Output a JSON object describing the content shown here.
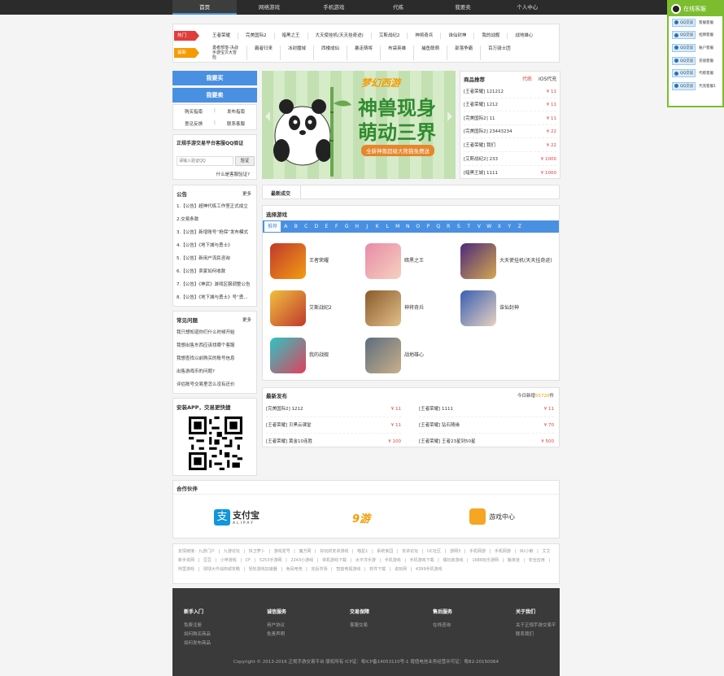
{
  "nav": [
    "首页",
    "网络游戏",
    "手机游戏",
    "代练",
    "我要卖",
    "个人中心"
  ],
  "hot": {
    "tag1": "热门",
    "tag2": "最新",
    "row1": [
      "王者荣耀",
      "完美国际2",
      "暗黑之王",
      "大天使挂机(天天挂奇迹)",
      "艾斯战纪2",
      "神将奇兵",
      "诛仙封神",
      "我的战舰",
      "战地雄心"
    ],
    "row2": [
      "勇者部落-决战手游宝贝大冒险",
      "霸者归来",
      "冰封魔域",
      "西楼成仙",
      "暴走萌将",
      "布袋英雄",
      "捕鱼联萌",
      "部落争霸",
      "百万骑士团"
    ]
  },
  "buy": "我要买",
  "sell": "我要卖",
  "quick": {
    "a": "购买指南",
    "b": "发布指南",
    "c": "意见反馈",
    "d": "联系客服"
  },
  "verify": {
    "title": "正规手游交易平台客服QQ验证",
    "placeholder": "请输入验证QQ",
    "button": "验证",
    "link": "什么是客服验证?"
  },
  "notice": {
    "title": "公告",
    "more": "更多",
    "items": [
      "1.【公告】超神代练工作室正式成立",
      "2.交易条款",
      "3.【公告】新增账号“抢保”发布模式",
      "4.【公告】《地下城与勇士》",
      "5.【公告】新用户流民咨询",
      "6.【公告】卖家如何收款",
      "7.【公告】《神武》游戏区服调整公告",
      "8.【公告】《地下城与勇士》号“勇..."
    ]
  },
  "faq": {
    "title": "常见问题",
    "more": "更多",
    "items": [
      "我只想知道你们什么时候开始",
      "我想出售东西应该找哪个客服",
      "我想查找以前购买的账号信息",
      "出售游戏币的问题?",
      "评估账号交易里怎么没有还价"
    ]
  },
  "app": {
    "title": "安装APP，交易更快捷"
  },
  "banner": {
    "logo": "梦幻西游",
    "line1": "神兽现身",
    "line2": "萌动三界",
    "sub": "全新神兽超级大熊猫免费送"
  },
  "recommend": {
    "title": "商品推荐",
    "tab1": "代练",
    "tab2": "IOS代充",
    "rows": [
      [
        "[王者荣耀] 121212",
        "¥ 11"
      ],
      [
        "[王者荣耀] 1212",
        "¥ 11"
      ],
      [
        "[完美国际2] 11",
        "¥ 11"
      ],
      [
        "[完美国际2] 23443234",
        "¥ 22"
      ],
      [
        "[王者荣耀] 我们",
        "¥ 22"
      ],
      [
        "[艾斯战纪2] 233",
        "¥ 1000"
      ],
      [
        "[暗黑王城] 1111",
        "¥ 1000"
      ]
    ]
  },
  "deal": {
    "title": "最新成交"
  },
  "select": {
    "title": "选择游戏",
    "all": "推荐",
    "letters": [
      "A",
      "B",
      "C",
      "D",
      "E",
      "F",
      "G",
      "H",
      "J",
      "K",
      "L",
      "M",
      "N",
      "O",
      "P",
      "Q",
      "R",
      "S",
      "T",
      "V",
      "W",
      "X",
      "Y",
      "Z"
    ],
    "games": [
      "王者荣耀",
      "暗黑之王",
      "大天使挂机(天天挂奇迹)",
      "艾斯战纪2",
      "神将奇兵",
      "诛仙封神",
      "我的战舰",
      "战地雄心"
    ]
  },
  "newest": {
    "title": "最新发布",
    "today_label": "今日新增",
    "today_count": "55720",
    "unit": "件",
    "rows": [
      [
        "[完美国际2] 1212",
        "¥ 11"
      ],
      [
        "[王者荣耀] 1111",
        "¥ 11"
      ],
      [
        "[王者荣耀] 贝黑云课堂",
        "¥ 11"
      ],
      [
        "[王者荣耀] 钻石随缘",
        "¥ 70"
      ],
      [
        "[王者荣耀] 黄金10连胜",
        "¥ 100"
      ],
      [
        "[王者荣耀] 王者23星到50星",
        "¥ 500"
      ]
    ]
  },
  "partner": {
    "title": "合作伙伴",
    "alipay": "支付宝",
    "alipay_en": "ALIPAY",
    "p2": "9游",
    "p3": "游戏中心"
  },
  "friends": "友情链接：九游门户 | 九游论坛 | 快卫萝卜 | 游戏发号 | 魔方网 | 好玩的安卓游戏 | 喵星1 | 系统家园 | 安卓论坛 | UC社区 | 游网3 | 手机网游 | 手机网游 | 9U小敏 | 艾艾新手资网 | 豆豆 | 小苹游戏 | CF | 5253手游网 | 2243小游戏 | 单机游戏下载 | 太平洋手游 | 手机游戏 | 手机游戏下载 | 偶玩家游戏 | 1688玩乐游网 | 魁夜道 | 安全应用 | 阿里游戏 | 球球大作战商城攻略 | 轻轮游戏加速器 | 免码电竞 | 完后市场 | 智能电视游戏 | 软件下载 | 说玩网 | 4399手机游戏",
  "footer": {
    "cols": [
      {
        "t": "新手入门",
        "i": [
          "免费注册",
          "如何购买商品",
          "如何发布商品"
        ]
      },
      {
        "t": "诚信服务",
        "i": [
          "用户协议",
          "免责声明"
        ]
      },
      {
        "t": "交易保障",
        "i": [
          "客服交易"
        ]
      },
      {
        "t": "售后服务",
        "i": [
          "在线咨询"
        ]
      },
      {
        "t": "关于我们",
        "i": [
          "关于正规手游交易平",
          "联系我们"
        ]
      }
    ],
    "copy": "Copyright © 2013-2016 正规手游交易平台  版权所有  ICP证：粤ICP备14053110号-1  增值电信业务经营许可证：粤B2-20150064"
  },
  "kefu": {
    "title": "在线客服",
    "btn": "QQ交谈",
    "items": [
      "客服客服",
      "招牌客服",
      "账户客服",
      "充值客服",
      "代练客服",
      "代充客服1"
    ]
  }
}
